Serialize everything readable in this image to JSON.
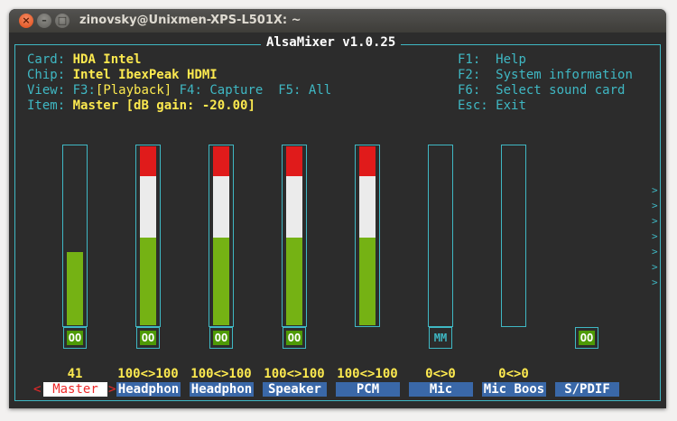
{
  "window": {
    "title": "zinovsky@Unixmen-XPS-L501X: ~"
  },
  "app": {
    "title": "AlsaMixer v1.0.25"
  },
  "info": {
    "card_label": "Card:",
    "card_value": "HDA Intel",
    "chip_label": "Chip:",
    "chip_value": "Intel IbexPeak HDMI",
    "view_label": "View:",
    "view_f3": "F3:",
    "view_playback": "[Playback]",
    "view_f4": "F4: Capture",
    "view_f5": "F5: All",
    "item_label": "Item:",
    "item_value": "Master [dB gain: -20.00]"
  },
  "help": [
    {
      "key": "F1:",
      "text": "Help"
    },
    {
      "key": "F2:",
      "text": "System information"
    },
    {
      "key": "F6:",
      "text": "Select sound card"
    },
    {
      "key": "Esc:",
      "text": "Exit"
    }
  ],
  "scroll_marker": ">",
  "colors": {
    "border": "#3fb8c4",
    "low": "#75b214",
    "mid": "#ebebeb",
    "high": "#e01b1b",
    "selected": "#ef2929",
    "label_bg": "#3a68a8",
    "badge_on": "#4e9a06"
  },
  "channels": [
    {
      "name": "Master",
      "volume": "41",
      "level": 0.41,
      "bar": true,
      "switch": "OO",
      "current": true
    },
    {
      "name": "Headphon",
      "volume": "100<>100",
      "level": 1.0,
      "bar": true,
      "switch": "OO",
      "current": false
    },
    {
      "name": "Headphon",
      "volume": "100<>100",
      "level": 1.0,
      "bar": true,
      "switch": "OO",
      "current": false
    },
    {
      "name": "Speaker",
      "volume": "100<>100",
      "level": 1.0,
      "bar": true,
      "switch": "OO",
      "current": false
    },
    {
      "name": "PCM",
      "volume": "100<>100",
      "level": 1.0,
      "bar": true,
      "switch": "",
      "current": false
    },
    {
      "name": "Mic",
      "volume": "0<>0",
      "level": 0.0,
      "bar": true,
      "switch": "MM",
      "current": false
    },
    {
      "name": "Mic Boos",
      "volume": "0<>0",
      "level": 0.0,
      "bar": true,
      "switch": "",
      "current": false
    },
    {
      "name": "S/PDIF",
      "volume": "",
      "level": 0.0,
      "bar": false,
      "switch": "OO",
      "current": false
    }
  ],
  "selection_arrows": {
    "left": "<",
    "right": ">"
  }
}
